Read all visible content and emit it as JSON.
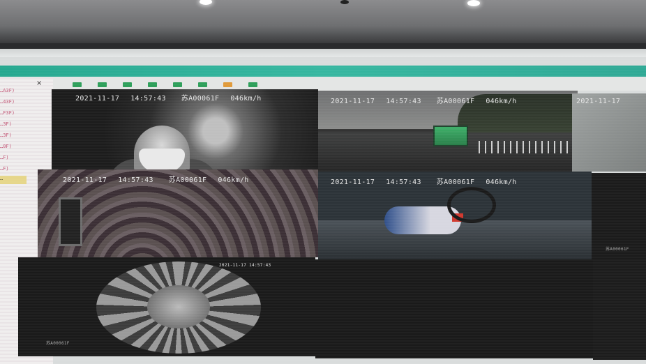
{
  "wall": {
    "left_close": "×",
    "left_items": [
      "…A3F)",
      "…43F)",
      "…F3F)",
      "…3F)",
      "…3F)",
      "…0F)",
      "…F)",
      "…F)",
      "…"
    ],
    "toolbar_colors": [
      "#2e9f5a",
      "#2e9f5a",
      "#2e9f5a",
      "#2e9f5a",
      "#2e9f5a",
      "#2e9f5a",
      "#e09a3a",
      "#2e9f5a"
    ]
  },
  "tiles": [
    {
      "date": "2021-11-17",
      "time": "14:57:43",
      "plate": "苏A00061F",
      "speed": "046km/h"
    },
    {
      "date": "2021-11-17",
      "time": "14:57:43",
      "plate": "苏A00061F",
      "speed": "046km/h"
    },
    {
      "date": "2021-11-17",
      "time": "",
      "plate": "",
      "speed": ""
    },
    {
      "date": "2021-11-17",
      "time": "14:57:43",
      "plate": "苏A00061F",
      "speed": "046km/h"
    },
    {
      "date": "2021-11-17",
      "time": "14:57:43",
      "plate": "苏A00061F",
      "speed": "046km/h"
    },
    {
      "date": "",
      "time": "",
      "plate": "苏A00061F",
      "speed": ""
    },
    {
      "date": "2021-11-17",
      "time": "14:57:43",
      "plate": "苏A00061F",
      "speed": ""
    }
  ]
}
